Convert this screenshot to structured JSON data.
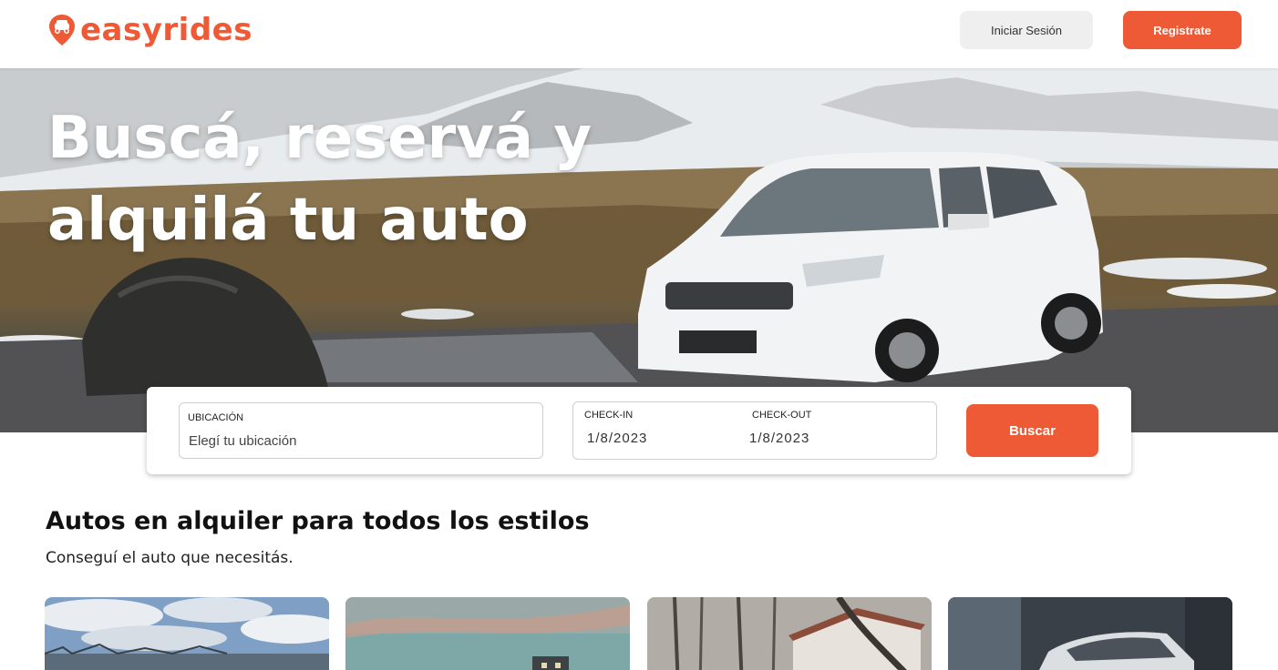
{
  "brand": {
    "name": "easyrides",
    "color": "#ee5a36",
    "logo_icon": "pin-car-icon"
  },
  "header": {
    "login_label": "Iniciar Sesión",
    "register_label": "Registrate"
  },
  "hero": {
    "title": "Buscá, reservá y alquilá tu auto",
    "image": "white-suv-snowy-mountains-photo"
  },
  "search": {
    "location_label": "UBICACIÓN",
    "location_placeholder": "Elegí tu ubicación",
    "checkin_label": "CHECK-IN",
    "checkout_label": "CHECK-OUT",
    "checkin_value": "1/8/2023",
    "checkout_value": "1/8/2023",
    "button_label": "Buscar"
  },
  "section": {
    "title": "Autos en alquiler para todos los estilos",
    "subtitle": "Conseguí el auto que necesitás."
  },
  "cards": [
    {
      "image": "cloudy-sky-field-photo"
    },
    {
      "image": "sunset-city-photo"
    },
    {
      "image": "forest-house-photo"
    },
    {
      "image": "car-street-photo"
    }
  ]
}
